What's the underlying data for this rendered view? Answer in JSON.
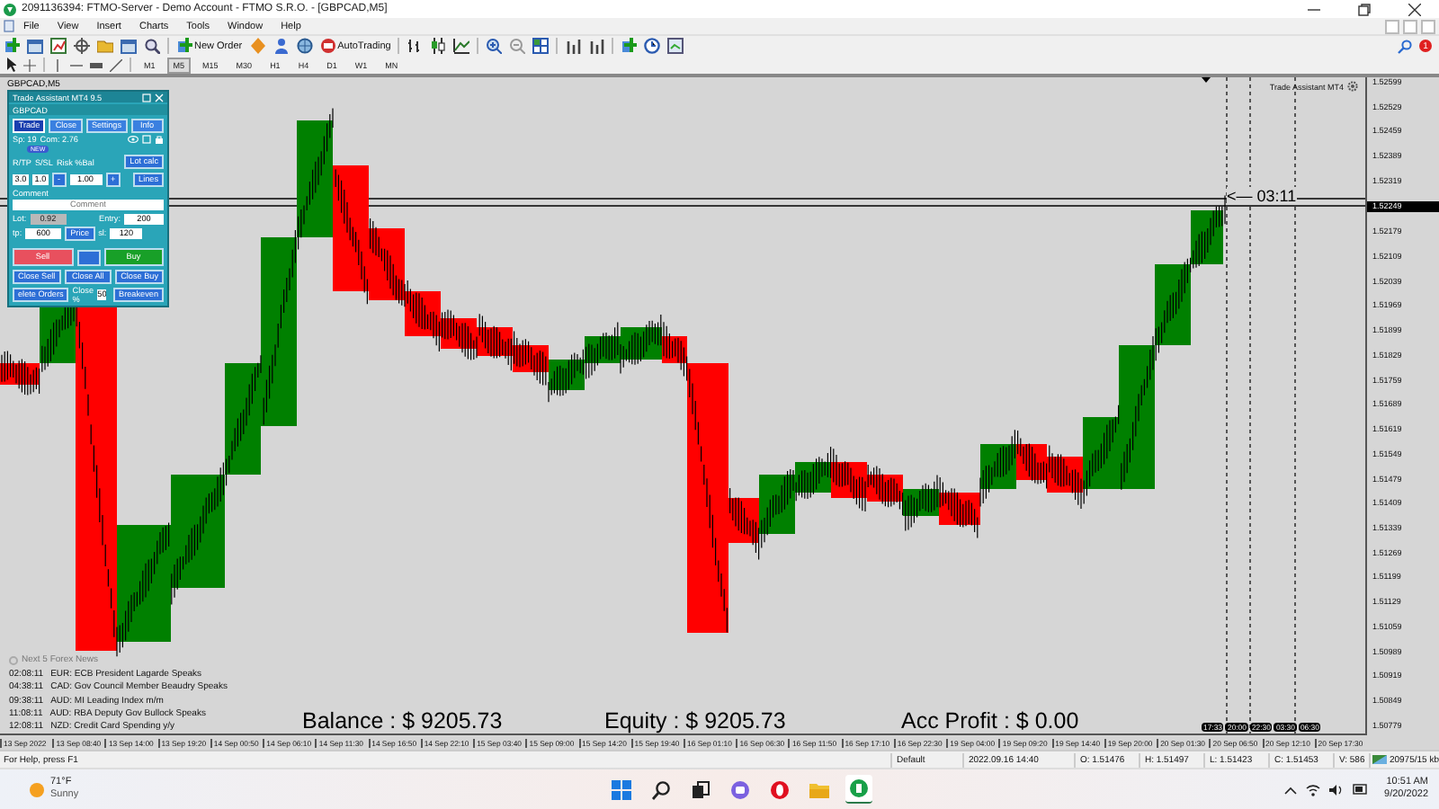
{
  "window": {
    "title": "2091136394: FTMO-Server - Demo Account - FTMO S.R.O. - [GBPCAD,M5]"
  },
  "menu": [
    "File",
    "View",
    "Insert",
    "Charts",
    "Tools",
    "Window",
    "Help"
  ],
  "toolbar": {
    "new_order": "New Order",
    "auto_trading": "AutoTrading",
    "notifications": "1"
  },
  "timeframes": [
    {
      "label": "M1",
      "selected": false
    },
    {
      "label": "M5",
      "selected": true
    },
    {
      "label": "M15",
      "selected": false
    },
    {
      "label": "M30",
      "selected": false
    },
    {
      "label": "H1",
      "selected": false
    },
    {
      "label": "H4",
      "selected": false
    },
    {
      "label": "D1",
      "selected": false
    },
    {
      "label": "W1",
      "selected": false
    },
    {
      "label": "MN",
      "selected": false
    }
  ],
  "chart": {
    "title": "GBPCAD,M5",
    "assistant_label": "Trade Assistant MT4",
    "countdown": "<— 03:11",
    "price_axis": [
      {
        "text": "1.52599",
        "kind": "tick"
      },
      {
        "text": "1.52529",
        "kind": "tick"
      },
      {
        "text": "1.52459",
        "kind": "tick"
      },
      {
        "text": "1.52389",
        "kind": "tick"
      },
      {
        "text": "1.52319",
        "kind": "tick"
      },
      {
        "text": "1.52249",
        "kind": "current"
      },
      {
        "text": "1.52179",
        "kind": "tick"
      },
      {
        "text": "1.52109",
        "kind": "tick"
      },
      {
        "text": "1.52039",
        "kind": "tick"
      },
      {
        "text": "1.51969",
        "kind": "tick"
      },
      {
        "text": "1.51899",
        "kind": "tick"
      },
      {
        "text": "1.51829",
        "kind": "tick"
      },
      {
        "text": "1.51759",
        "kind": "tick"
      },
      {
        "text": "1.51689",
        "kind": "tick"
      },
      {
        "text": "1.51619",
        "kind": "tick"
      },
      {
        "text": "1.51549",
        "kind": "tick"
      },
      {
        "text": "1.51479",
        "kind": "tick"
      },
      {
        "text": "1.51409",
        "kind": "tick"
      },
      {
        "text": "1.51339",
        "kind": "tick"
      },
      {
        "text": "1.51269",
        "kind": "tick"
      },
      {
        "text": "1.51199",
        "kind": "tick"
      },
      {
        "text": "1.51129",
        "kind": "tick"
      },
      {
        "text": "1.51059",
        "kind": "tick"
      },
      {
        "text": "1.50989",
        "kind": "tick"
      },
      {
        "text": "1.50919",
        "kind": "tick"
      },
      {
        "text": "1.50849",
        "kind": "tick"
      },
      {
        "text": "1.50779",
        "kind": "tick"
      }
    ],
    "time_axis": [
      "13 Sep 2022",
      "13 Sep 08:40",
      "13 Sep 14:00",
      "13 Sep 19:20",
      "14 Sep 00:50",
      "14 Sep 06:10",
      "14 Sep 11:30",
      "14 Sep 16:50",
      "14 Sep 22:10",
      "15 Sep 03:40",
      "15 Sep 09:00",
      "15 Sep 14:20",
      "15 Sep 19:40",
      "16 Sep 01:10",
      "16 Sep 06:30",
      "16 Sep 11:50",
      "16 Sep 17:10",
      "16 Sep 22:30",
      "19 Sep 04:00",
      "19 Sep 09:20",
      "19 Sep 14:40",
      "19 Sep 20:00",
      "20 Sep 01:30",
      "20 Sep 06:50",
      "20 Sep 12:10",
      "20 Sep 17:30"
    ],
    "time_tags": [
      "17:33",
      "20:00",
      "22:30",
      "03:30",
      "06:30"
    ],
    "news": {
      "title": "Next 5 Forex News",
      "items": [
        {
          "time": "02:08:11",
          "text": "EUR: ECB President Lagarde Speaks"
        },
        {
          "time": "04:38:11",
          "text": "CAD: Gov Council Member Beaudry Speaks"
        },
        {
          "time": "09:38:11",
          "text": "AUD: MI Leading Index m/m"
        },
        {
          "time": "11:08:11",
          "text": "AUD: RBA Deputy Gov Bullock Speaks"
        },
        {
          "time": "12:08:11",
          "text": "NZD: Credit Card Spending y/y"
        }
      ]
    },
    "balance": "Balance : $ 9205.73",
    "equity": "Equity : $ 9205.73",
    "profit": "Acc Profit : $ 0.00"
  },
  "trade_panel": {
    "title": "Trade Assistant MT4 9.5",
    "symbol": "GBPCAD",
    "tabs": [
      {
        "label": "Trade",
        "selected": true
      },
      {
        "label": "Close",
        "selected": false
      },
      {
        "label": "Settings",
        "selected": false
      },
      {
        "label": "Info",
        "selected": false
      }
    ],
    "spread": "Sp: 19",
    "commission": "Com: 2.76",
    "badge": "NEW",
    "rtp": {
      "label": "R/TP",
      "value": "3.0"
    },
    "ssl": {
      "label": "S/SL",
      "value": "1.0"
    },
    "risk": {
      "label": "Risk %Bal",
      "value": "1.00",
      "minus": "-",
      "plus": "+"
    },
    "lot_calc": "Lot calc",
    "lines": "Lines",
    "comment_label": "Comment",
    "comment_placeholder": "Comment",
    "lot": {
      "label": "Lot:",
      "value": "0.92",
      "disabled": true
    },
    "entry": {
      "label": "Entry:",
      "value": "200"
    },
    "tp": {
      "label": "tp:",
      "value": "600"
    },
    "price": "Price",
    "sl": {
      "label": "sl:",
      "value": "120"
    },
    "sell": "Sell",
    "buy": "Buy",
    "close_buttons": [
      "Close Sell",
      "Close All",
      "Close Buy"
    ],
    "delete_orders": "elete Orders",
    "close_pct": {
      "label": "Close %",
      "value": "50"
    },
    "breakeven": "Breakeven"
  },
  "status_bar": {
    "help": "For Help, press F1",
    "profile": "Default",
    "time": "2022.09.16 14:40",
    "open": "O: 1.51476",
    "high": "H: 1.51497",
    "low": "L: 1.51423",
    "close": "C: 1.51453",
    "volume": "V: 586",
    "traffic": "20975/15 kb"
  },
  "taskbar": {
    "temperature": "71°F",
    "condition": "Sunny",
    "time": "10:51 AM",
    "date": "9/20/2022"
  }
}
